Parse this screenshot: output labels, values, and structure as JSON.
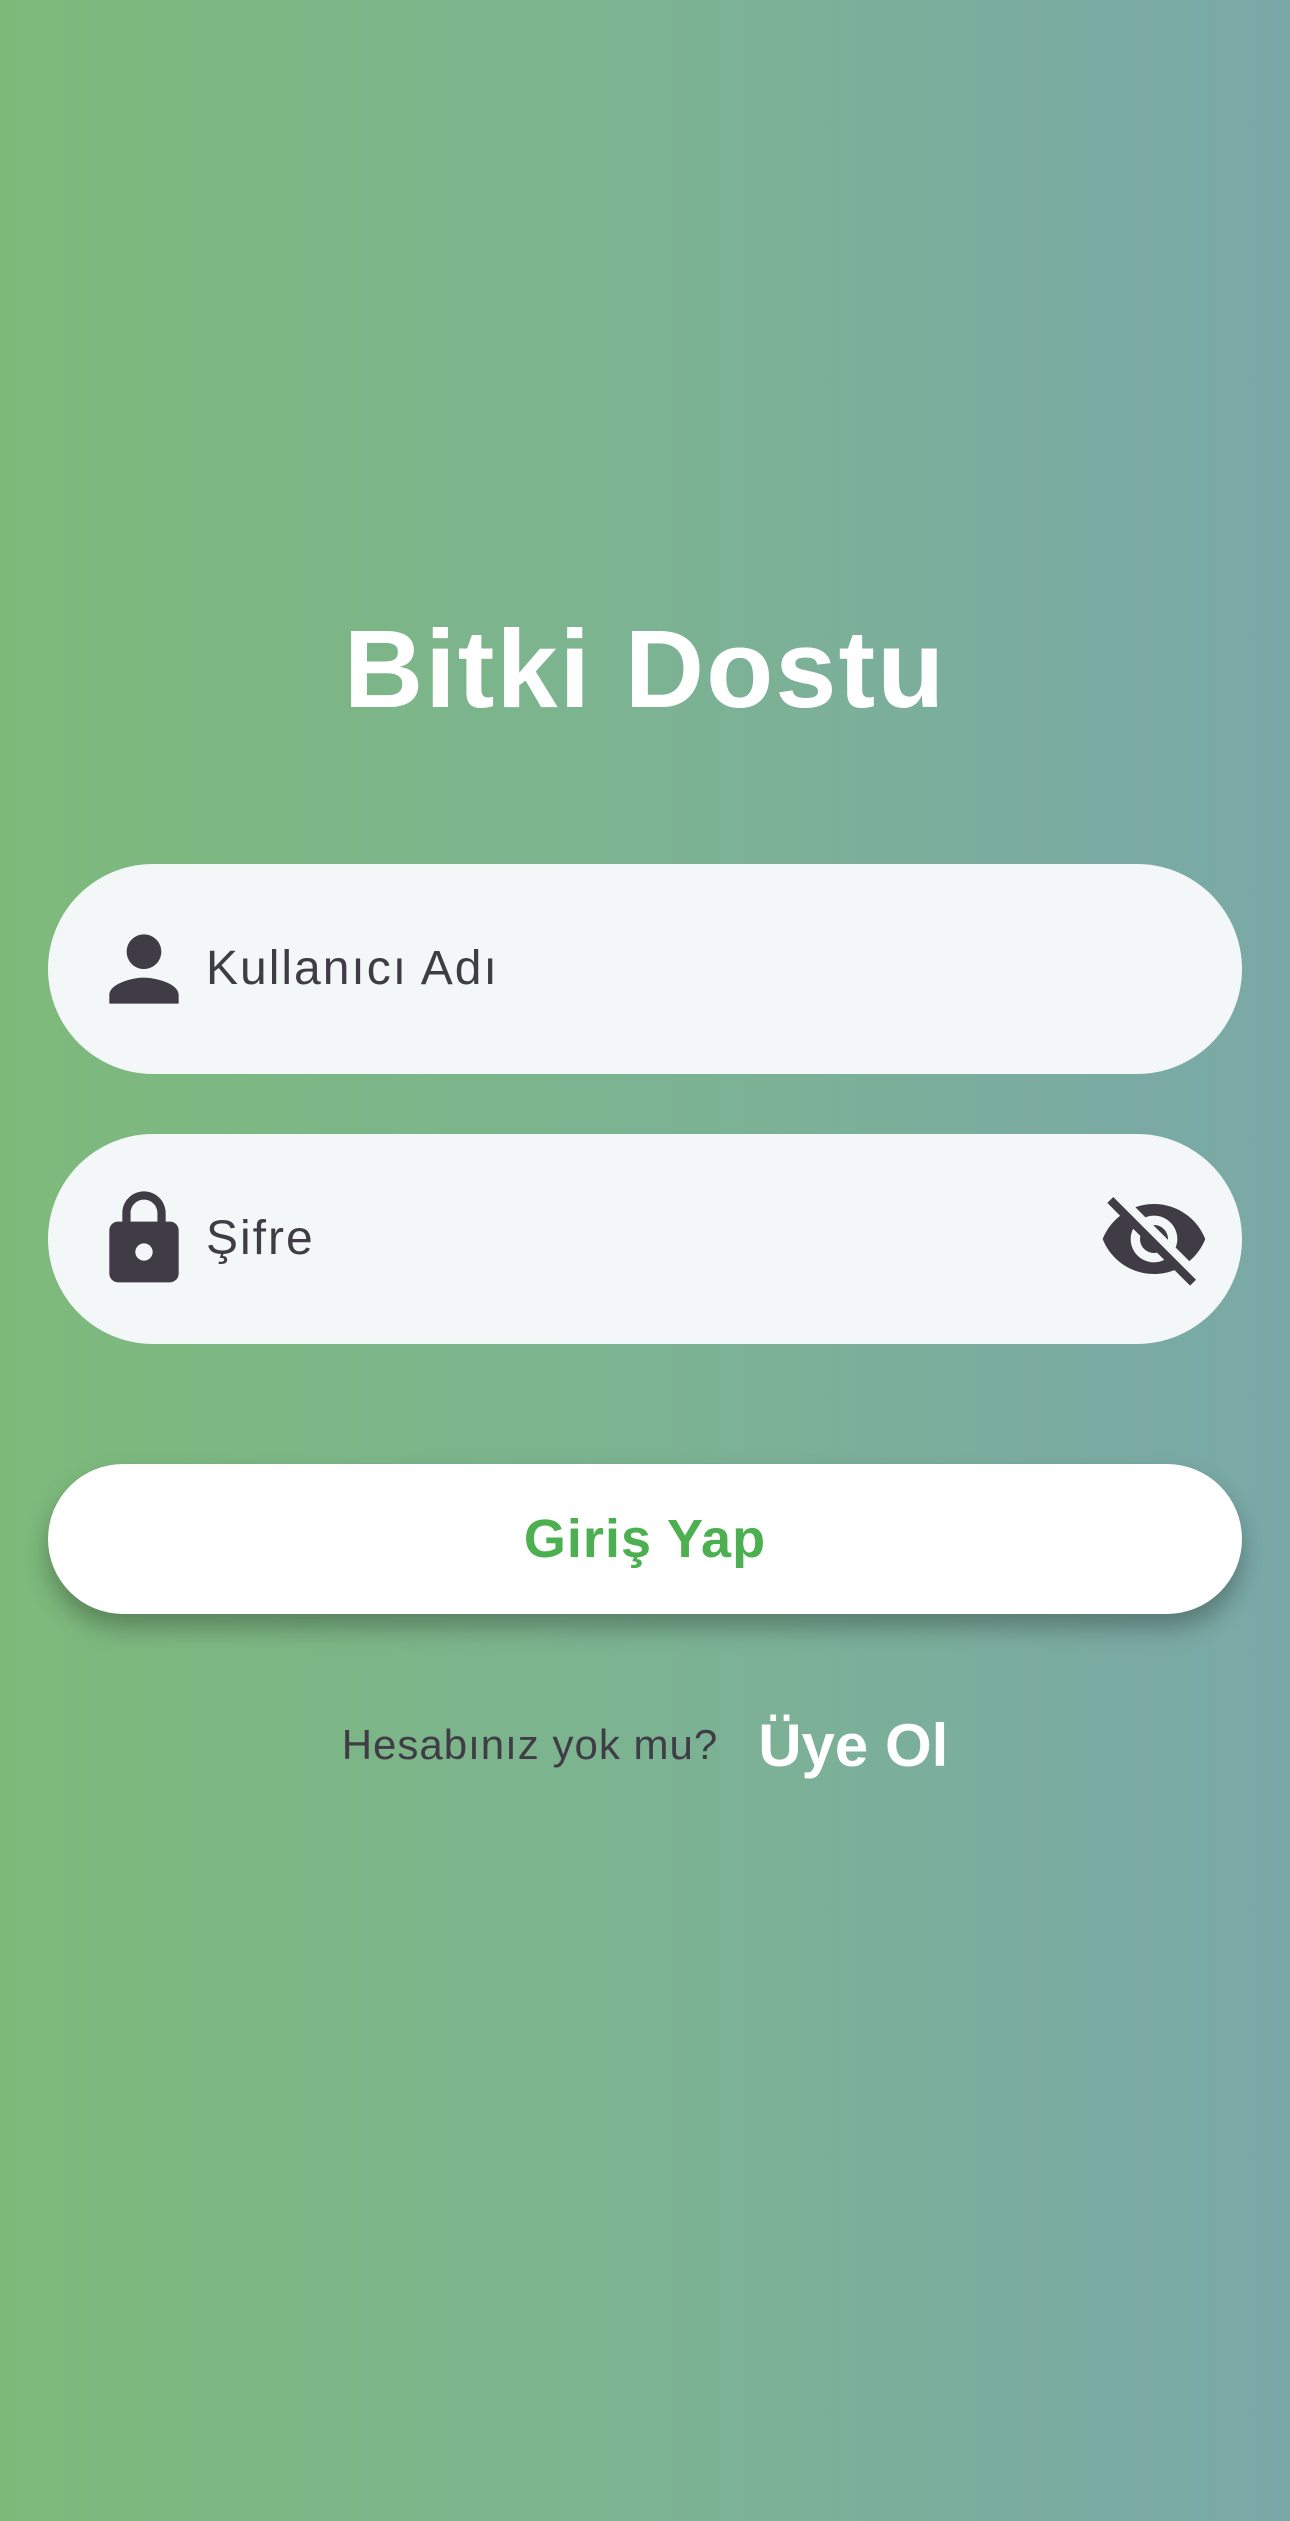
{
  "app": {
    "title": "Bitki Dostu"
  },
  "login_form": {
    "username": {
      "placeholder": "Kullanıcı Adı",
      "icon": "person-icon"
    },
    "password": {
      "placeholder": "Şifre",
      "icon": "lock-icon",
      "visibility_toggle_icon": "eye-off-icon"
    },
    "submit_label": "Giriş Yap"
  },
  "signup": {
    "prompt": "Hesabınız yok mu?",
    "link_label": "Üye Ol"
  },
  "colors": {
    "background_gradient_start": "#7dba7a",
    "background_gradient_end": "#7aa8a8",
    "field_background": "#f3f7f7",
    "button_text": "#4caf50",
    "text_dark": "#3f3c46",
    "text_light": "#ffffff"
  }
}
